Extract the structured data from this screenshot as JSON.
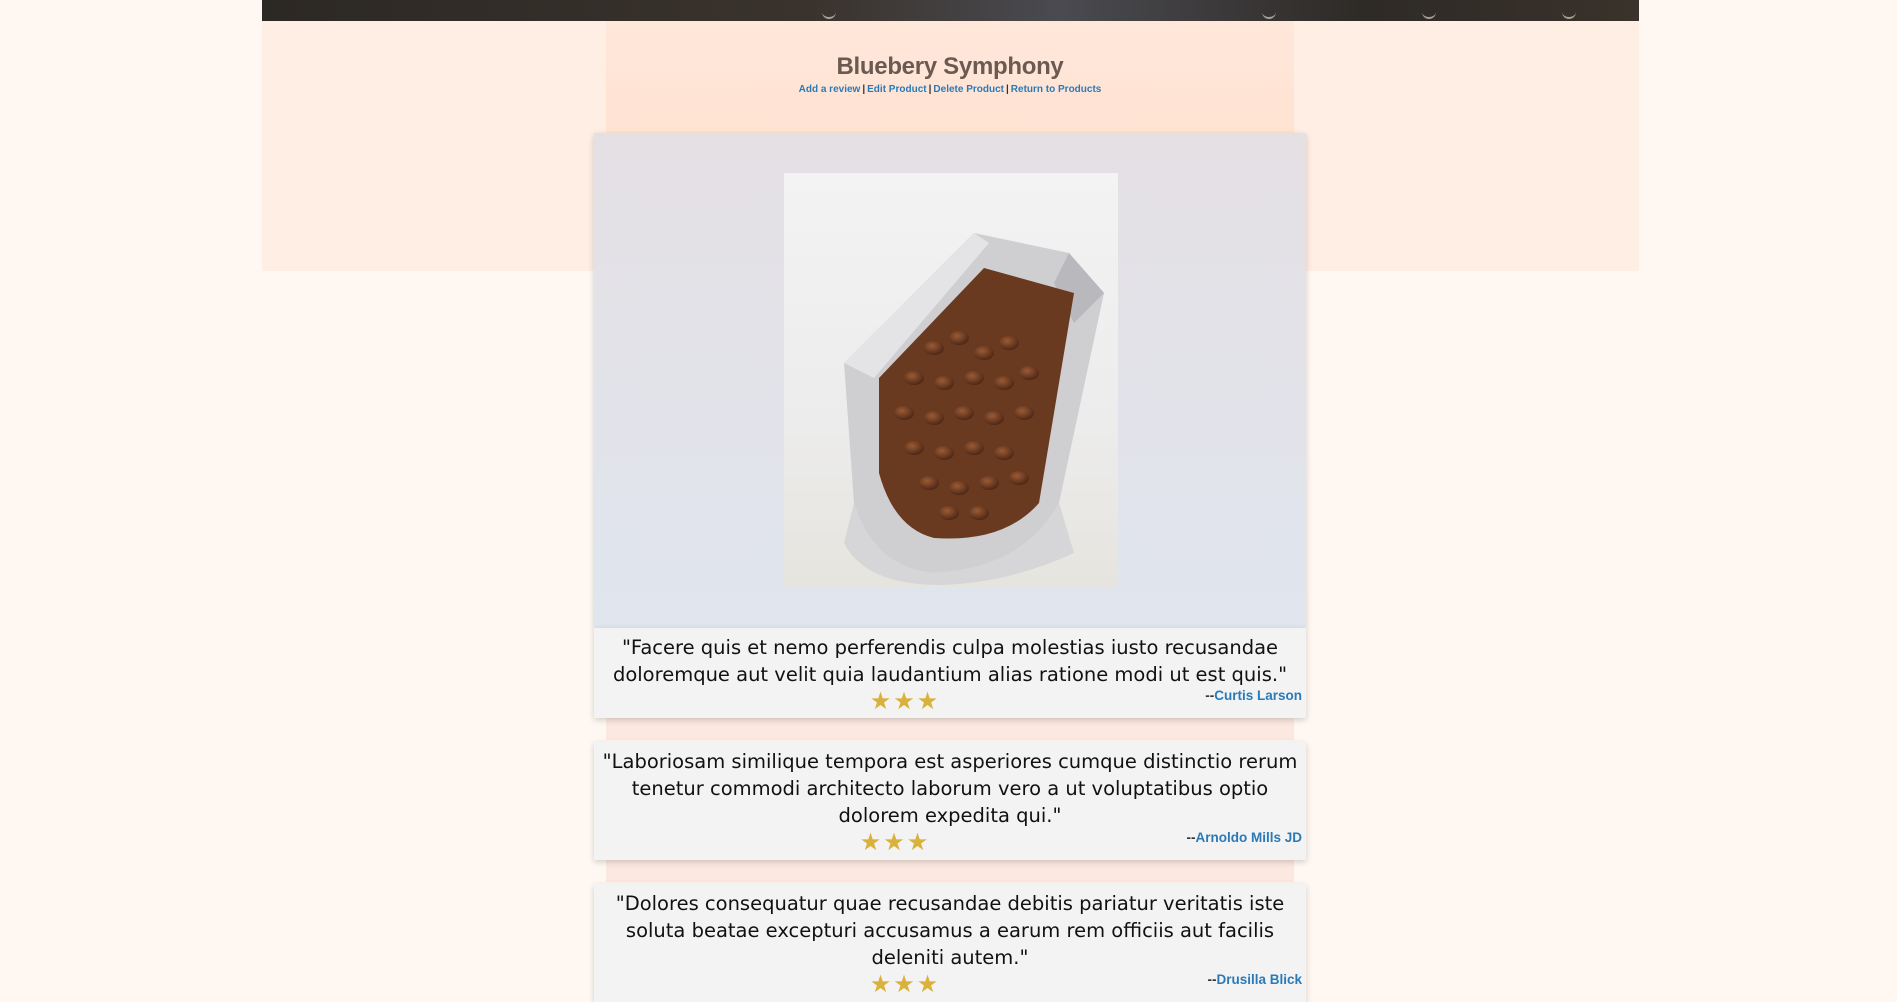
{
  "product": {
    "title": "Bluebery Symphony",
    "image_alt": "Bag of coffee beans"
  },
  "nav": {
    "add_review": "Add a review",
    "edit_product": "Edit Product",
    "delete_product": "Delete Product",
    "return_to_products": "Return to Products",
    "separator": "|"
  },
  "reviews": [
    {
      "text": "\"Facere quis et nemo perferendis culpa molestias iusto recusandae doloremque aut velit quia laudantium alias ratione modi ut est quis.\"",
      "stars": "★★★",
      "rating": 3,
      "author_prefix": "--",
      "author": "Curtis Larson"
    },
    {
      "text": "\"Laboriosam similique tempora est asperiores cumque distinctio rerum tenetur commodi architecto laborum vero a ut voluptatibus optio dolorem expedita qui.\"",
      "stars": "★★★",
      "rating": 3,
      "author_prefix": "--",
      "author": "Arnoldo Mills JD"
    },
    {
      "text": "\"Dolores consequatur quae recusandae debitis pariatur veritatis iste soluta beatae excepturi accusamus a earum rem officiis aut facilis deleniti autem.\"",
      "stars": "★★★",
      "rating": 3,
      "author_prefix": "--",
      "author": "Drusilla Blick"
    }
  ],
  "colors": {
    "link": "#2a7ab8",
    "star": "#d9b13b",
    "page_bg": "#fff8f2",
    "header_bg": "#ffe7da"
  }
}
